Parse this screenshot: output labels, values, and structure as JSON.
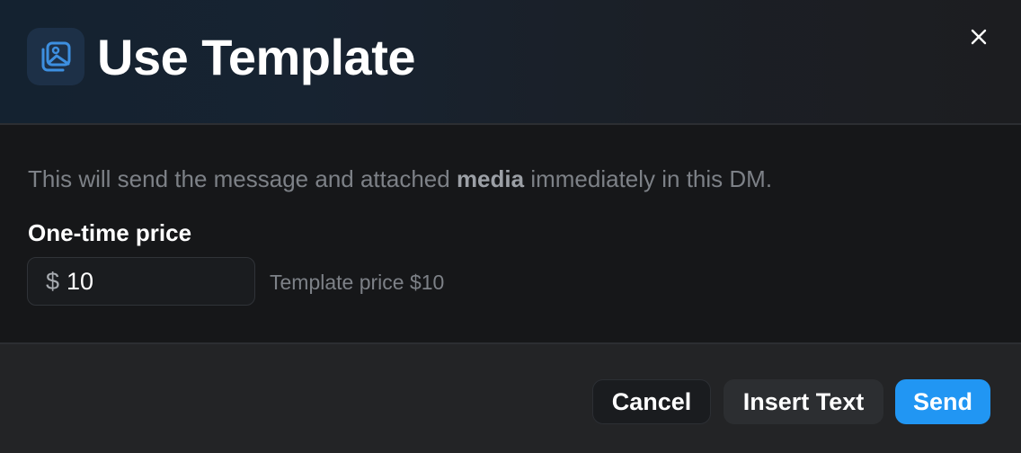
{
  "dialog": {
    "title": "Use Template",
    "title_icon": "image-template-icon",
    "close_icon": "close-icon"
  },
  "body": {
    "description_prefix": "This will send the message and attached ",
    "description_bold": "media",
    "description_suffix": " immediately in this DM.",
    "price_label": "One-time price",
    "currency_symbol": "$",
    "price_value": "10",
    "template_price_note": "Template price $10"
  },
  "footer": {
    "cancel_label": "Cancel",
    "insert_text_label": "Insert Text",
    "send_label": "Send"
  },
  "colors": {
    "accent": "#2196f3",
    "background": "#161719",
    "footer_background": "#232426"
  }
}
